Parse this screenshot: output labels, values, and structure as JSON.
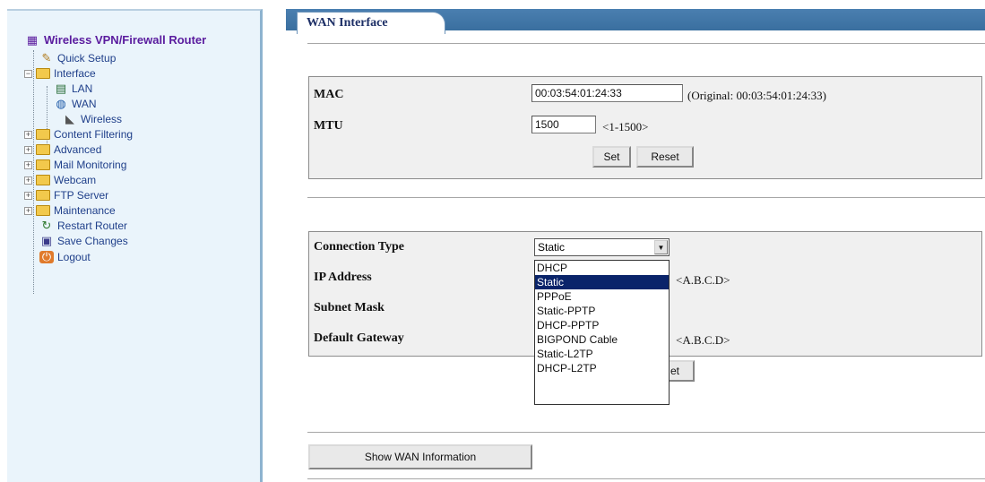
{
  "sidebar": {
    "title": "Wireless VPN/Firewall Router",
    "items": [
      {
        "label": "Quick Setup"
      },
      {
        "label": "Interface"
      },
      {
        "label": "LAN"
      },
      {
        "label": "WAN"
      },
      {
        "label": "Wireless"
      },
      {
        "label": "Content Filtering"
      },
      {
        "label": "Advanced"
      },
      {
        "label": "Mail Monitoring"
      },
      {
        "label": "Webcam"
      },
      {
        "label": "FTP Server"
      },
      {
        "label": "Maintenance"
      },
      {
        "label": "Restart Router"
      },
      {
        "label": "Save Changes"
      },
      {
        "label": "Logout"
      }
    ]
  },
  "tab": {
    "label": "WAN Interface"
  },
  "mac_section": {
    "mac_label": "MAC",
    "mac_value": "00:03:54:01:24:33",
    "mac_original": "(Original: 00:03:54:01:24:33)",
    "mtu_label": "MTU",
    "mtu_value": "1500",
    "mtu_range": "<1-1500>",
    "set_label": "Set",
    "reset_label": "Reset"
  },
  "connection_section": {
    "conn_type_label": "Connection Type",
    "conn_type_selected": "Static",
    "ip_label": "IP Address",
    "ip_hint": "<A.B.C.D>",
    "subnet_label": "Subnet Mask",
    "gateway_label": "Default Gateway",
    "gateway_hint": "<A.B.C.D>",
    "set_label_partial": "et",
    "options": [
      "DHCP",
      "Static",
      "PPPoE",
      "Static-PPTP",
      "DHCP-PPTP",
      "BIGPOND Cable",
      "Static-L2TP",
      "DHCP-L2TP"
    ]
  },
  "show_wan_info_label": "Show WAN Information",
  "colors": {
    "sidebar_bg": "#eaf4fb",
    "topbar": "#3a6f9f",
    "selection": "#0a246a",
    "title": "#5a1b9e"
  }
}
